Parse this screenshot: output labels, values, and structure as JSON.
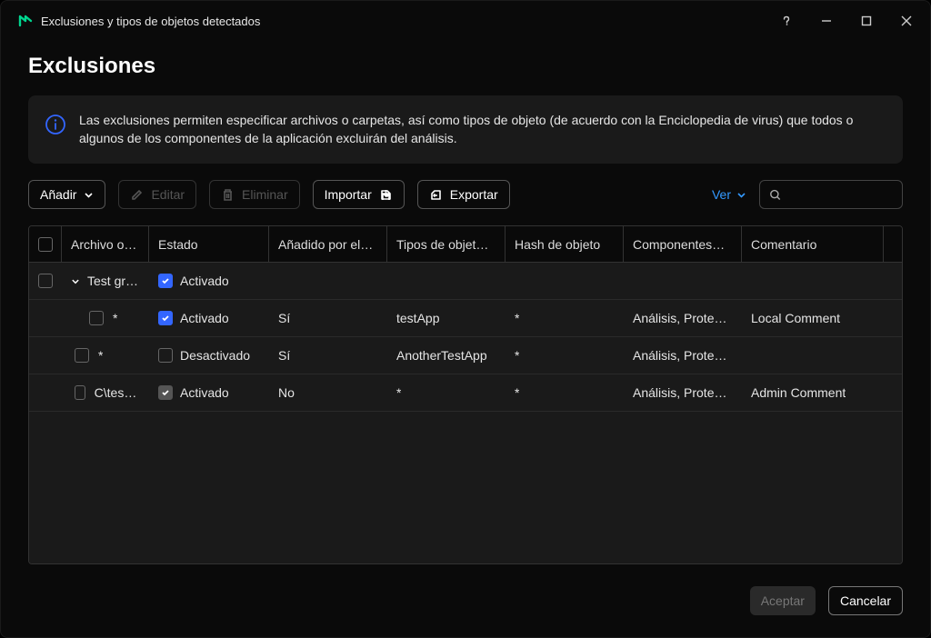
{
  "window_title": "Exclusiones y tipos de objetos detectados",
  "page_title": "Exclusiones",
  "info_text": "Las exclusiones permiten especificar archivos o carpetas, así como tipos de objeto (de acuerdo con la Enciclopedia de virus) que todos o algunos de los componentes de la aplicación excluirán del análisis.",
  "toolbar": {
    "add": "Añadir",
    "edit": "Editar",
    "delete": "Eliminar",
    "import": "Importar",
    "export": "Exportar",
    "view": "Ver",
    "search_placeholder": ""
  },
  "columns": {
    "file": "Archivo o c…",
    "state": "Estado",
    "added": "Añadido por el…",
    "types": "Tipos de objet…",
    "hash": "Hash de objeto",
    "components": "Componentes…",
    "comment": "Comentario"
  },
  "group": {
    "name": "Test gro…",
    "state": "Activado"
  },
  "rows": [
    {
      "file": "*",
      "state": "Activado",
      "state_checked": "blue",
      "added": "Sí",
      "types": "testApp",
      "hash": "*",
      "components": "Análisis, Protecci…",
      "comment": "Local Comment"
    },
    {
      "file": "*",
      "state": "Desactivado",
      "state_checked": "none",
      "added": "Sí",
      "types": "AnotherTestApp",
      "hash": "*",
      "components": "Análisis, Protecci…",
      "comment": ""
    },
    {
      "file": "C\\test\\tes…",
      "state": "Activado",
      "state_checked": "grey",
      "added": "No",
      "types": "*",
      "hash": "*",
      "components": "Análisis, Protecci…",
      "comment": "Admin Comment"
    }
  ],
  "footer": {
    "accept": "Aceptar",
    "cancel": "Cancelar"
  }
}
